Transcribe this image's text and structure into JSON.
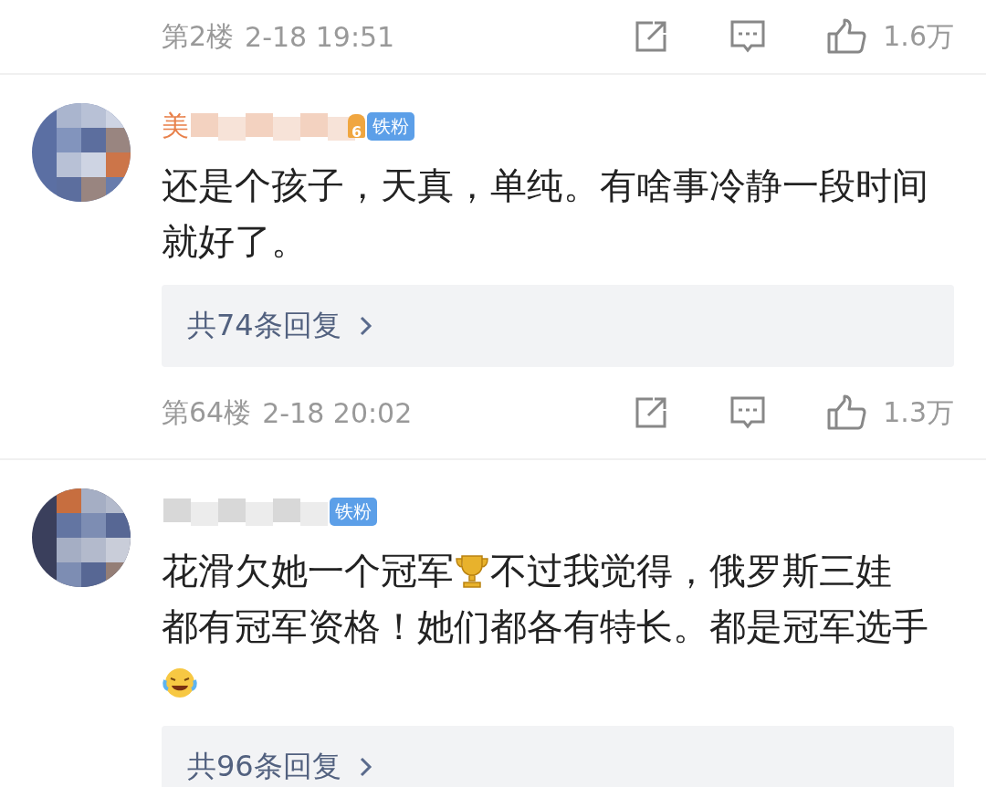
{
  "entries": [
    {
      "kind": "footer",
      "floor": "第2楼",
      "time": "2-18 19:51",
      "likes": "1.6万"
    },
    {
      "kind": "comment",
      "name": "美",
      "name_blurred": true,
      "fan_level": "6",
      "badge": "铁粉",
      "body": [
        {
          "kind": "text",
          "text": "还是个孩子，天真，单纯。有啥事冷静一段时间就好了。"
        }
      ],
      "replies": "共74条回复"
    },
    {
      "kind": "footer",
      "floor": "第64楼",
      "time": "2-18 20:02",
      "likes": "1.3万"
    },
    {
      "kind": "comment",
      "name_blurred": true,
      "badge": "铁粉",
      "body": [
        {
          "kind": "text",
          "text": "花滑欠她一个冠军"
        },
        {
          "kind": "trophy"
        },
        {
          "kind": "text",
          "text": "不过我觉得，俄罗斯三娃"
        },
        {
          "kind": "text",
          "text": "都有冠军资格！她们都各有特长。都是冠军选"
        },
        {
          "kind": "text",
          "text": "手"
        },
        {
          "kind": "emoji"
        }
      ],
      "replies": "共96条回复"
    }
  ]
}
